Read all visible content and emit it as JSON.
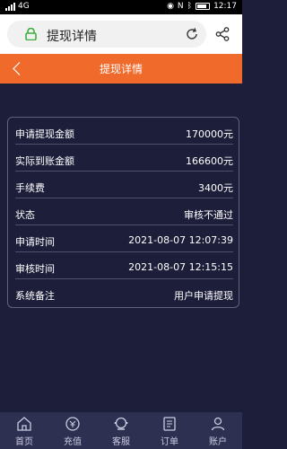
{
  "status_bar": {
    "carrier_badge": "4G",
    "nfc": "N",
    "time": "12:17"
  },
  "browser": {
    "url_title": "提现详情",
    "icons": [
      "lock-icon",
      "reload-icon",
      "share-icon"
    ]
  },
  "header": {
    "title": "提现详情",
    "back_icon": "chevron-left-icon",
    "color": "#f06a2b"
  },
  "details": [
    {
      "label": "申请提现金额",
      "value": "170000元"
    },
    {
      "label": "实际到账金额",
      "value": "166600元"
    },
    {
      "label": "手续费",
      "value": "3400元"
    },
    {
      "label": "状态",
      "value": "审核不通过"
    },
    {
      "label": "申请时间",
      "value": "2021-08-07 12:07:39"
    },
    {
      "label": "审核时间",
      "value": "2021-08-07 12:15:15"
    },
    {
      "label": "系统备注",
      "value": "用户申请提现"
    }
  ],
  "bottom_nav": [
    {
      "label": "首页",
      "icon": "home-icon"
    },
    {
      "label": "充值",
      "icon": "recharge-icon"
    },
    {
      "label": "客服",
      "icon": "support-icon"
    },
    {
      "label": "订单",
      "icon": "orders-icon"
    },
    {
      "label": "账户",
      "icon": "account-icon"
    }
  ]
}
